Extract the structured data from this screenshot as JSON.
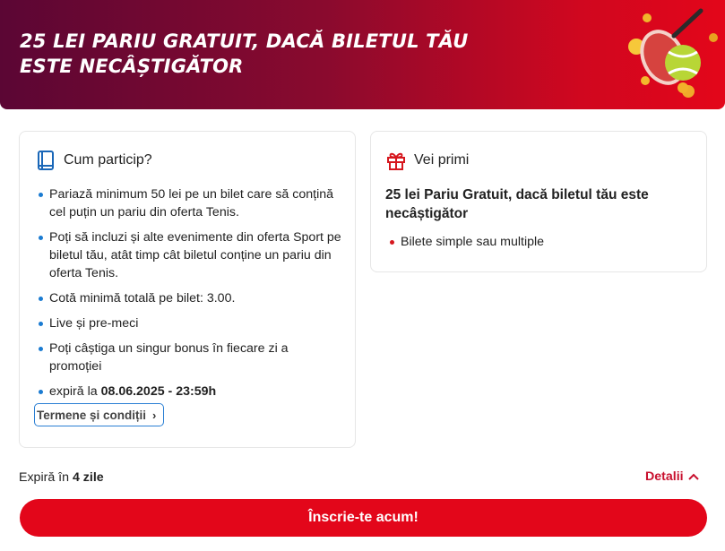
{
  "banner": {
    "title": "25 LEI PARIU GRATUIT, DACĂ BILETUL TĂU ESTE NECÂȘTIGĂTOR",
    "art_icon": "tennis-ball-racket-coins-icon"
  },
  "how_to": {
    "icon": "book-icon",
    "title": "Cum particip?",
    "bullets": [
      "Pariază minimum 50 lei pe un bilet care să conțină cel puțin un pariu din oferta Tenis.",
      "Poți să incluzi și alte evenimente din oferta Sport pe biletul tău, atât timp cât biletul conține un pariu din oferta Tenis.",
      "Cotă minimă totală pe bilet: 3.00.",
      "Live și pre-meci",
      "Poți câștiga un singur bonus în fiecare zi a promoției"
    ],
    "expiry_prefix": "expiră la",
    "expiry_date": "08.06.2025 - 23:59h",
    "terms_label": "Termene și condiții"
  },
  "reward": {
    "icon": "gift-icon",
    "title": "Vei primi",
    "headline": "25 lei Pariu Gratuit, dacă biletul tău este necâștigător",
    "bullets": [
      "Bilete simple sau multiple"
    ]
  },
  "footer": {
    "expires_prefix": "Expiră în",
    "expires_value": "4 zile",
    "details_label": "Detalii",
    "cta_label": "Înscrie-te acum!"
  },
  "colors": {
    "brand_red": "#e3061a",
    "banner_dark": "#5b0634",
    "bullet_blue": "#1a7bd1",
    "bullet_red": "#d6171e"
  }
}
